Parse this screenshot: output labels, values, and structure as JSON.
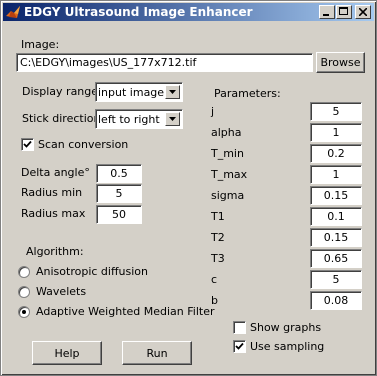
{
  "window": {
    "title": "EDGY Ultrasound Image Enhancer"
  },
  "image": {
    "label": "Image:",
    "path": "C:\\EDGY\\images\\US_177x712.tif",
    "browse_label": "Browse"
  },
  "display_range": {
    "label": "Display range",
    "value": "input image"
  },
  "stick_direction": {
    "label": "Stick direction",
    "value": "left to right"
  },
  "scan_conversion": {
    "label": "Scan conversion",
    "checked": true
  },
  "delta_angle": {
    "label": "Delta angle°",
    "value": "0.5"
  },
  "radius_min": {
    "label": "Radius min",
    "value": "5"
  },
  "radius_max": {
    "label": "Radius max",
    "value": "50"
  },
  "algorithm": {
    "label": "Algorithm:",
    "options": [
      {
        "label": "Anisotropic diffusion",
        "selected": false
      },
      {
        "label": "Wavelets",
        "selected": false
      },
      {
        "label": "Adaptive Weighted Median Filter",
        "selected": true
      }
    ]
  },
  "parameters": {
    "label": "Parameters:",
    "items": [
      {
        "name": "j",
        "value": "5"
      },
      {
        "name": "alpha",
        "value": "1"
      },
      {
        "name": "T_min",
        "value": "0.2"
      },
      {
        "name": "T_max",
        "value": "1"
      },
      {
        "name": "sigma",
        "value": "0.15"
      },
      {
        "name": "T1",
        "value": "0.1"
      },
      {
        "name": "T2",
        "value": "0.15"
      },
      {
        "name": "T3",
        "value": "0.65"
      },
      {
        "name": "c",
        "value": "5"
      },
      {
        "name": "b",
        "value": "0.08"
      }
    ]
  },
  "show_graphs": {
    "label": "Show graphs",
    "checked": false
  },
  "use_sampling": {
    "label": "Use sampling",
    "checked": true
  },
  "buttons": {
    "help": "Help",
    "run": "Run"
  }
}
